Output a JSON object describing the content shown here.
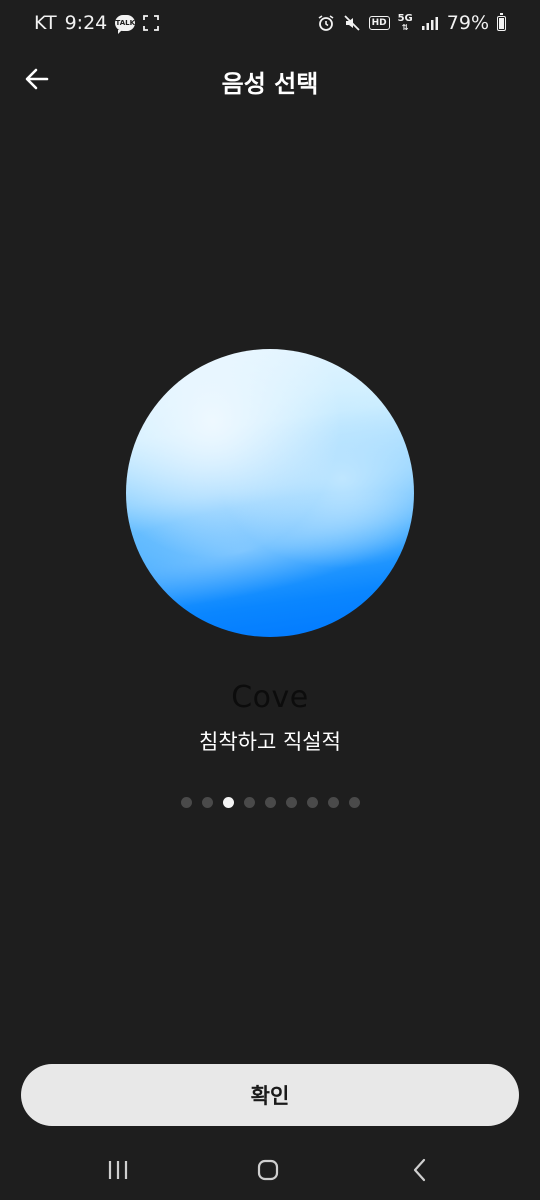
{
  "status_bar": {
    "carrier": "KT",
    "time": "9:24",
    "talk_badge": "TALK",
    "hd_badge": "HD",
    "network": "5G",
    "battery": "79%"
  },
  "header": {
    "title": "음성 선택",
    "back_icon": "arrow-left-icon"
  },
  "voice": {
    "name": "Cove",
    "description": "침착하고 직설적",
    "orb_colors": [
      "#e8f6ff",
      "#8fd1ff",
      "#0a86ff"
    ]
  },
  "pager": {
    "total": 9,
    "active_index": 2
  },
  "footer": {
    "confirm_label": "확인"
  },
  "nav_bar": {
    "recents_icon": "recents-icon",
    "home_icon": "home-icon",
    "back_icon": "nav-back-icon"
  },
  "colors": {
    "background": "#1e1e1e",
    "button": "#e8e8e8",
    "dot_inactive": "#4a4a4a",
    "dot_active": "#f4f4f4"
  }
}
